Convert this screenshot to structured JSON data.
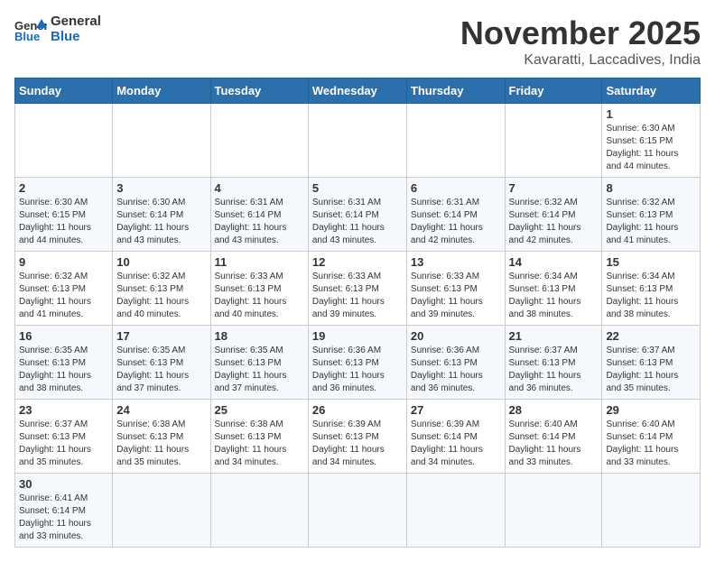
{
  "header": {
    "logo_general": "General",
    "logo_blue": "Blue",
    "month_title": "November 2025",
    "location": "Kavaratti, Laccadives, India"
  },
  "weekdays": [
    "Sunday",
    "Monday",
    "Tuesday",
    "Wednesday",
    "Thursday",
    "Friday",
    "Saturday"
  ],
  "weeks": [
    [
      {
        "day": "",
        "info": ""
      },
      {
        "day": "",
        "info": ""
      },
      {
        "day": "",
        "info": ""
      },
      {
        "day": "",
        "info": ""
      },
      {
        "day": "",
        "info": ""
      },
      {
        "day": "",
        "info": ""
      },
      {
        "day": "1",
        "info": "Sunrise: 6:30 AM\nSunset: 6:15 PM\nDaylight: 11 hours\nand 44 minutes."
      }
    ],
    [
      {
        "day": "2",
        "info": "Sunrise: 6:30 AM\nSunset: 6:15 PM\nDaylight: 11 hours\nand 44 minutes."
      },
      {
        "day": "3",
        "info": "Sunrise: 6:30 AM\nSunset: 6:14 PM\nDaylight: 11 hours\nand 43 minutes."
      },
      {
        "day": "4",
        "info": "Sunrise: 6:31 AM\nSunset: 6:14 PM\nDaylight: 11 hours\nand 43 minutes."
      },
      {
        "day": "5",
        "info": "Sunrise: 6:31 AM\nSunset: 6:14 PM\nDaylight: 11 hours\nand 43 minutes."
      },
      {
        "day": "6",
        "info": "Sunrise: 6:31 AM\nSunset: 6:14 PM\nDaylight: 11 hours\nand 42 minutes."
      },
      {
        "day": "7",
        "info": "Sunrise: 6:32 AM\nSunset: 6:14 PM\nDaylight: 11 hours\nand 42 minutes."
      },
      {
        "day": "8",
        "info": "Sunrise: 6:32 AM\nSunset: 6:13 PM\nDaylight: 11 hours\nand 41 minutes."
      }
    ],
    [
      {
        "day": "9",
        "info": "Sunrise: 6:32 AM\nSunset: 6:13 PM\nDaylight: 11 hours\nand 41 minutes."
      },
      {
        "day": "10",
        "info": "Sunrise: 6:32 AM\nSunset: 6:13 PM\nDaylight: 11 hours\nand 40 minutes."
      },
      {
        "day": "11",
        "info": "Sunrise: 6:33 AM\nSunset: 6:13 PM\nDaylight: 11 hours\nand 40 minutes."
      },
      {
        "day": "12",
        "info": "Sunrise: 6:33 AM\nSunset: 6:13 PM\nDaylight: 11 hours\nand 39 minutes."
      },
      {
        "day": "13",
        "info": "Sunrise: 6:33 AM\nSunset: 6:13 PM\nDaylight: 11 hours\nand 39 minutes."
      },
      {
        "day": "14",
        "info": "Sunrise: 6:34 AM\nSunset: 6:13 PM\nDaylight: 11 hours\nand 38 minutes."
      },
      {
        "day": "15",
        "info": "Sunrise: 6:34 AM\nSunset: 6:13 PM\nDaylight: 11 hours\nand 38 minutes."
      }
    ],
    [
      {
        "day": "16",
        "info": "Sunrise: 6:35 AM\nSunset: 6:13 PM\nDaylight: 11 hours\nand 38 minutes."
      },
      {
        "day": "17",
        "info": "Sunrise: 6:35 AM\nSunset: 6:13 PM\nDaylight: 11 hours\nand 37 minutes."
      },
      {
        "day": "18",
        "info": "Sunrise: 6:35 AM\nSunset: 6:13 PM\nDaylight: 11 hours\nand 37 minutes."
      },
      {
        "day": "19",
        "info": "Sunrise: 6:36 AM\nSunset: 6:13 PM\nDaylight: 11 hours\nand 36 minutes."
      },
      {
        "day": "20",
        "info": "Sunrise: 6:36 AM\nSunset: 6:13 PM\nDaylight: 11 hours\nand 36 minutes."
      },
      {
        "day": "21",
        "info": "Sunrise: 6:37 AM\nSunset: 6:13 PM\nDaylight: 11 hours\nand 36 minutes."
      },
      {
        "day": "22",
        "info": "Sunrise: 6:37 AM\nSunset: 6:13 PM\nDaylight: 11 hours\nand 35 minutes."
      }
    ],
    [
      {
        "day": "23",
        "info": "Sunrise: 6:37 AM\nSunset: 6:13 PM\nDaylight: 11 hours\nand 35 minutes."
      },
      {
        "day": "24",
        "info": "Sunrise: 6:38 AM\nSunset: 6:13 PM\nDaylight: 11 hours\nand 35 minutes."
      },
      {
        "day": "25",
        "info": "Sunrise: 6:38 AM\nSunset: 6:13 PM\nDaylight: 11 hours\nand 34 minutes."
      },
      {
        "day": "26",
        "info": "Sunrise: 6:39 AM\nSunset: 6:13 PM\nDaylight: 11 hours\nand 34 minutes."
      },
      {
        "day": "27",
        "info": "Sunrise: 6:39 AM\nSunset: 6:14 PM\nDaylight: 11 hours\nand 34 minutes."
      },
      {
        "day": "28",
        "info": "Sunrise: 6:40 AM\nSunset: 6:14 PM\nDaylight: 11 hours\nand 33 minutes."
      },
      {
        "day": "29",
        "info": "Sunrise: 6:40 AM\nSunset: 6:14 PM\nDaylight: 11 hours\nand 33 minutes."
      }
    ],
    [
      {
        "day": "30",
        "info": "Sunrise: 6:41 AM\nSunset: 6:14 PM\nDaylight: 11 hours\nand 33 minutes."
      },
      {
        "day": "",
        "info": ""
      },
      {
        "day": "",
        "info": ""
      },
      {
        "day": "",
        "info": ""
      },
      {
        "day": "",
        "info": ""
      },
      {
        "day": "",
        "info": ""
      },
      {
        "day": "",
        "info": ""
      }
    ]
  ]
}
